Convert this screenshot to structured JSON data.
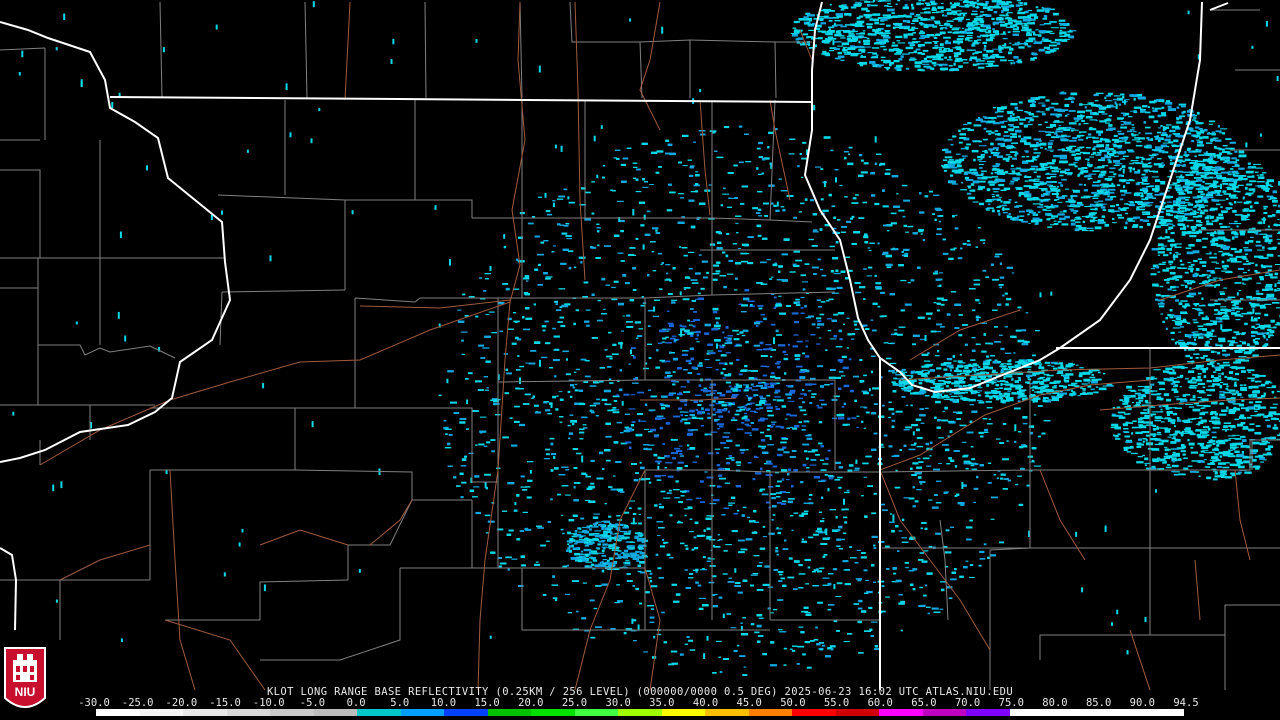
{
  "product": {
    "caption": "KLOT LONG RANGE BASE REFLECTIVITY (0.25KM / 256 LEVEL) (000000/0000 0.5 DEG) 2025-06-23 16:02 UTC  ATLAS.NIU.EDU"
  },
  "legend": {
    "labels": [
      "-30.0",
      "-25.0",
      "-20.0",
      "-15.0",
      "-10.0",
      "-5.0",
      "0.0",
      "5.0",
      "10.0",
      "15.0",
      "20.0",
      "25.0",
      "30.0",
      "35.0",
      "40.0",
      "45.0",
      "50.0",
      "55.0",
      "60.0",
      "65.0",
      "70.0",
      "75.0",
      "80.0",
      "85.0",
      "90.0",
      "94.5"
    ],
    "colors": [
      "#ffffff",
      "#f4f4f4",
      "#e6e6e6",
      "#d8d8d8",
      "#cacaca",
      "#bcbcbc",
      "#00c8c8",
      "#00a0ff",
      "#0040ff",
      "#00c000",
      "#00e000",
      "#40ff40",
      "#a0ff00",
      "#ffff00",
      "#ffc000",
      "#ff8000",
      "#ff0000",
      "#d00000",
      "#ff00ff",
      "#c000c0",
      "#8000ff",
      "#ffffff",
      "#ffffff",
      "#ffffff",
      "#ffffff"
    ]
  },
  "logo": {
    "text": "NIU"
  },
  "colors": {
    "background": "#000000",
    "state_border": "#ffffff",
    "county_border": "#808080",
    "road": "#a05a3c",
    "echo_light": "#00d8e8",
    "echo_mid": "#10a8e0",
    "echo_deep": "#1868d8",
    "radar_site": "#000000",
    "logo_red": "#c8102e"
  }
}
